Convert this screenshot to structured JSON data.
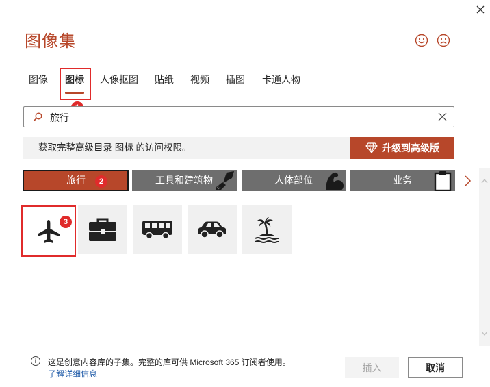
{
  "dialog": {
    "title": "图像集",
    "close_icon": "close-icon",
    "feedback_icons": [
      "smile-icon",
      "frown-icon"
    ]
  },
  "tabs": [
    {
      "label": "图像",
      "active": false
    },
    {
      "label": "图标",
      "active": true
    },
    {
      "label": "人像抠图",
      "active": false
    },
    {
      "label": "贴纸",
      "active": false
    },
    {
      "label": "视频",
      "active": false
    },
    {
      "label": "插图",
      "active": false
    },
    {
      "label": "卡通人物",
      "active": false
    }
  ],
  "search": {
    "value": "旅行",
    "placeholder": "",
    "icon": "search-icon",
    "clear_icon": "clear-icon"
  },
  "upsell": {
    "message": "获取完整高级目录 图标 的访问权限。",
    "button_label": "升级到高级版",
    "button_icon": "diamond-icon"
  },
  "categories": [
    {
      "label": "旅行",
      "active": true,
      "icon": ""
    },
    {
      "label": "工具和建筑物",
      "active": false,
      "icon": "paintbrush-icon"
    },
    {
      "label": "人体部位",
      "active": false,
      "icon": "flexed-arm-icon"
    },
    {
      "label": "业务",
      "active": false,
      "icon": "clipboard-icon"
    }
  ],
  "categories_next_icon": "chevron-right-icon",
  "icon_results": [
    {
      "name": "airplane-icon",
      "selected": true
    },
    {
      "name": "briefcase-icon",
      "selected": false
    },
    {
      "name": "bus-icon",
      "selected": false
    },
    {
      "name": "car-icon",
      "selected": false
    },
    {
      "name": "palm-island-icon",
      "selected": false
    }
  ],
  "annotations": {
    "tab_marker": "1",
    "category_marker": "2",
    "result_marker": "3"
  },
  "footer": {
    "info_text": "这是创意内容库的子集。完整的库可供 Microsoft 365 订阅者使用。",
    "learn_more": "了解详细信息"
  },
  "buttons": {
    "insert": "插入",
    "insert_enabled": false,
    "cancel": "取消"
  },
  "colors": {
    "accent": "#b7472a",
    "highlight": "#e02b2b",
    "category_gray": "#6e6e6e",
    "tile_bg": "#f0f0f0"
  }
}
